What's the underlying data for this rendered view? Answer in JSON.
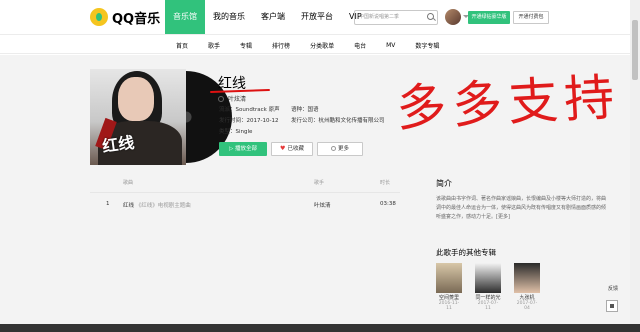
{
  "brand": {
    "name": "QQ音乐"
  },
  "nav": [
    "音乐馆",
    "我的音乐",
    "客户端",
    "开放平台",
    "VIP"
  ],
  "nav_active_index": 0,
  "search": {
    "placeholder": "中国新说唱第二季"
  },
  "header_buttons": {
    "vip": "开通绿钻豪华版",
    "pay": "开通付费包"
  },
  "subnav": [
    "首页",
    "歌手",
    "专辑",
    "排行榜",
    "分类歌单",
    "电台",
    "MV",
    "数字专辑"
  ],
  "album": {
    "cover_title": "红线",
    "title": "红线",
    "singer": "叶炫清",
    "genre_label": "流派：",
    "genre": "Soundtrack 原声",
    "language_label": "语种：",
    "language": "国语",
    "release_label": "发行时间：",
    "release": "2017-10-12",
    "company_label": "发行公司：",
    "company": "杭州酷和文化传播有限公司",
    "type_label": "类型：",
    "type": "Single"
  },
  "actions": {
    "play": "播放全部",
    "fav": "已收藏",
    "more": "更多"
  },
  "handwriting": "多多支持",
  "table": {
    "headers": {
      "song": "歌曲",
      "singer": "歌手",
      "time": "时长"
    },
    "rows": [
      {
        "num": "1",
        "name": "红线",
        "sub": "《红线》电视剧主题曲",
        "singer": "叶炫清",
        "time": "03:38"
      }
    ]
  },
  "intro": {
    "title": "简介",
    "text": "该歌曲由书字作词、著名作曲家谣娘曲，长恨编曲及小楼等大师打造的，将曲调中的最佳人命运合为一体，使得这曲风为既有传唱度又有剧情画面质感的倾听盛宴之作，感动力十足。[更多]"
  },
  "other_albums": {
    "title": "此歌手的其他专辑",
    "items": [
      {
        "name": "空间菱里",
        "date": "2016-11-11"
      },
      {
        "name": "同一样的光",
        "date": "2017-07-11"
      },
      {
        "name": "九张机",
        "date": "2017-07-04"
      }
    ]
  },
  "feedback": "反馈",
  "colors": {
    "accent": "#31c27c",
    "handwriting": "#e01010"
  }
}
